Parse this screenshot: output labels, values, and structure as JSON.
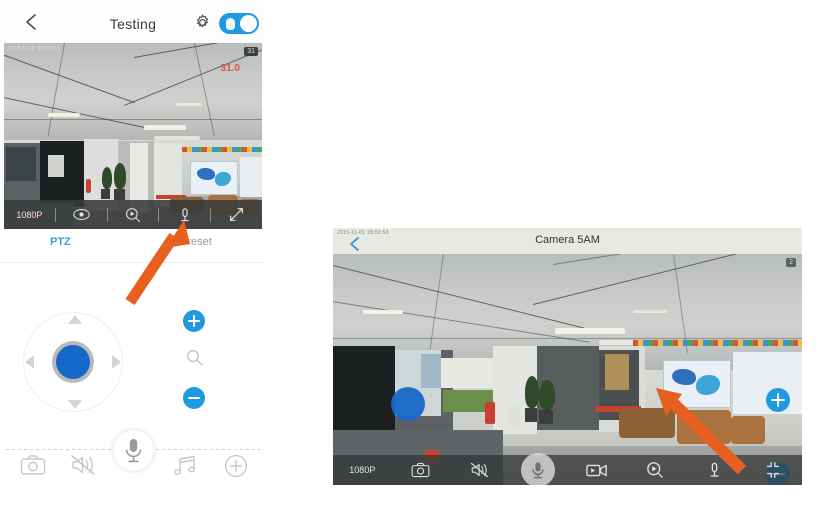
{
  "portrait": {
    "header": {
      "back_icon": "chevron-left-icon",
      "title": "Testing",
      "gear_icon": "gear-icon",
      "toggle_state": "on",
      "toggle_color": "#1e9ae0"
    },
    "video": {
      "timestamp": "2015-11-01 18:02:53",
      "badge": "31",
      "overlay_text": "31.0",
      "scene": "indoor-lobby-camera-feed"
    },
    "video_toolbar": {
      "resolution_label": "1080P",
      "items": [
        {
          "name": "resolution-button",
          "label": "1080P"
        },
        {
          "name": "eye-icon",
          "label": ""
        },
        {
          "name": "playback-zoom-icon",
          "label": ""
        },
        {
          "name": "microphone-icon",
          "label": ""
        },
        {
          "name": "fullscreen-icon",
          "label": ""
        }
      ]
    },
    "tabs": [
      {
        "label": "PTZ",
        "active": true,
        "color": "#3b9fe0"
      },
      {
        "label": "Preset",
        "active": false,
        "color": "#9a9a9a"
      }
    ],
    "ptz": {
      "joystick_color": "#1668c8",
      "arrows": [
        "up",
        "down",
        "left",
        "right"
      ]
    },
    "zoom_controls": {
      "plus_label": "+",
      "magnifier_icon": "magnifier-icon",
      "minus_label": "-",
      "button_color": "#1e9ae0"
    },
    "bottom_bar": [
      {
        "name": "snapshot-icon",
        "label": ""
      },
      {
        "name": "speaker-muted-icon",
        "label": ""
      },
      {
        "name": "microphone-talk-icon",
        "label": ""
      },
      {
        "name": "music-note-icon",
        "label": ""
      },
      {
        "name": "add-icon",
        "label": ""
      }
    ]
  },
  "landscape": {
    "timestamp": "2015-11-01 18:02:53",
    "back_icon": "chevron-left-icon",
    "title": "Camera 5AM",
    "badge": "2",
    "joystick_color": "#1668c8",
    "zoom_controls": {
      "plus_label": "+",
      "minus_label": "-",
      "button_color": "#1e9ae0"
    },
    "video_toolbar": {
      "resolution_label": "1080P",
      "items": [
        {
          "name": "resolution-button",
          "label": "1080P"
        },
        {
          "name": "snapshot-icon",
          "label": ""
        },
        {
          "name": "speaker-muted-icon",
          "label": ""
        },
        {
          "name": "microphone-talk-icon",
          "label": ""
        },
        {
          "name": "record-video-icon",
          "label": ""
        },
        {
          "name": "playback-zoom-icon",
          "label": ""
        },
        {
          "name": "microphone-icon",
          "label": ""
        },
        {
          "name": "exit-fullscreen-icon",
          "label": ""
        }
      ]
    }
  },
  "annotations": {
    "arrow_color": "#e8601f",
    "arrow_1_target": "portrait-video-toolbar-microphone",
    "arrow_2_target": "landscape-video-microphone"
  }
}
